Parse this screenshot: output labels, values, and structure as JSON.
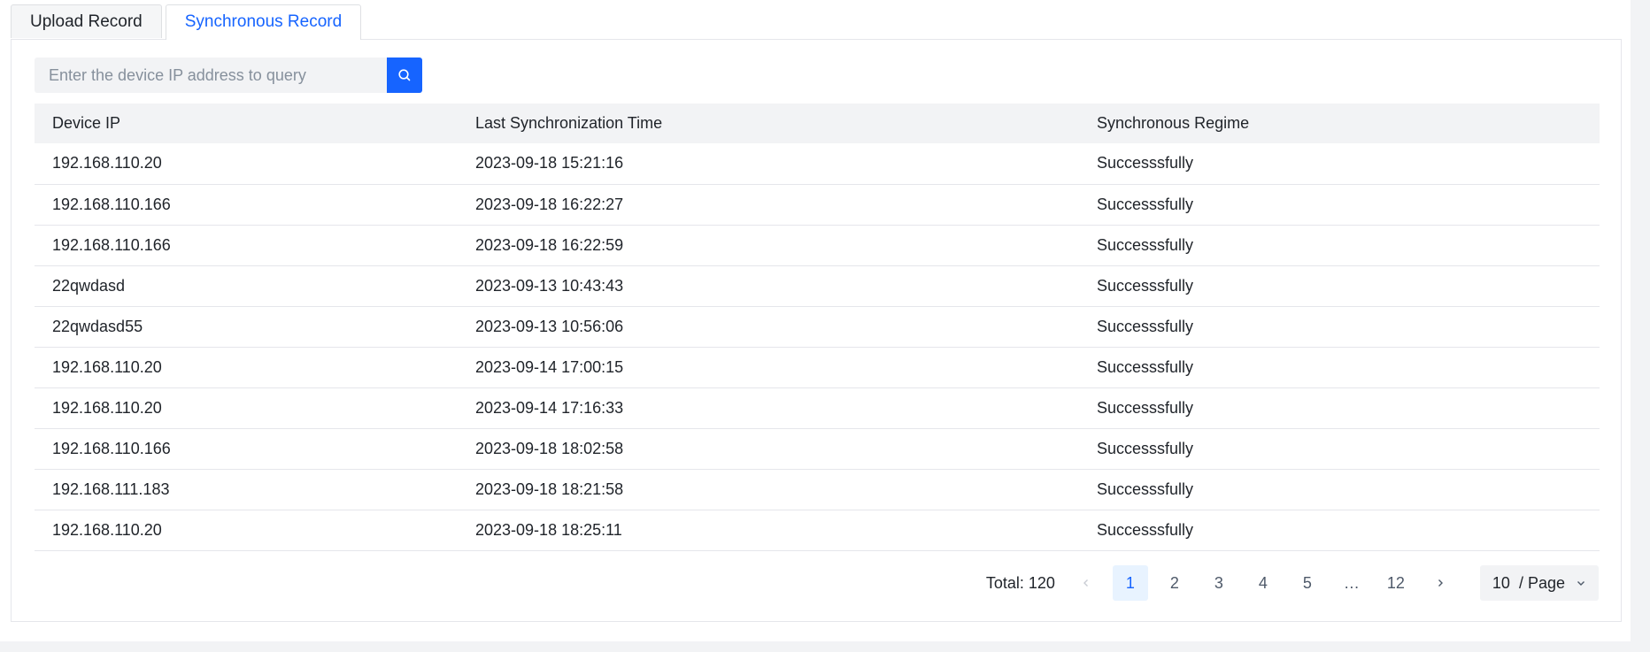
{
  "tabs": [
    {
      "label": "Upload Record",
      "active": false
    },
    {
      "label": "Synchronous Record",
      "active": true
    }
  ],
  "search": {
    "placeholder": "Enter the device IP address to query",
    "value": ""
  },
  "table": {
    "headers": [
      "Device IP",
      "Last Synchronization Time",
      "Synchronous Regime"
    ],
    "rows": [
      [
        "192.168.110.20",
        "2023-09-18 15:21:16",
        "Successsfully"
      ],
      [
        "192.168.110.166",
        "2023-09-18 16:22:27",
        "Successsfully"
      ],
      [
        "192.168.110.166",
        "2023-09-18 16:22:59",
        "Successsfully"
      ],
      [
        "22qwdasd",
        "2023-09-13 10:43:43",
        "Successsfully"
      ],
      [
        "22qwdasd55",
        "2023-09-13 10:56:06",
        "Successsfully"
      ],
      [
        "192.168.110.20",
        "2023-09-14 17:00:15",
        "Successsfully"
      ],
      [
        "192.168.110.20",
        "2023-09-14 17:16:33",
        "Successsfully"
      ],
      [
        "192.168.110.166",
        "2023-09-18 18:02:58",
        "Successsfully"
      ],
      [
        "192.168.111.183",
        "2023-09-18 18:21:58",
        "Successsfully"
      ],
      [
        "192.168.110.20",
        "2023-09-18 18:25:11",
        "Successsfully"
      ]
    ]
  },
  "pagination": {
    "total_label": "Total: 120",
    "pages": [
      "1",
      "2",
      "3",
      "4",
      "5",
      "…",
      "12"
    ],
    "current": "1",
    "page_size_label": "10  / Page"
  },
  "colors": {
    "accent": "#1664ff",
    "active_page_bg": "#e8f3ff",
    "header_bg": "#f2f3f5"
  },
  "icons": {
    "search_button": "search-icon",
    "prev": "chevron-left-icon",
    "next": "chevron-right-icon",
    "size_dropdown": "chevron-down-icon"
  }
}
